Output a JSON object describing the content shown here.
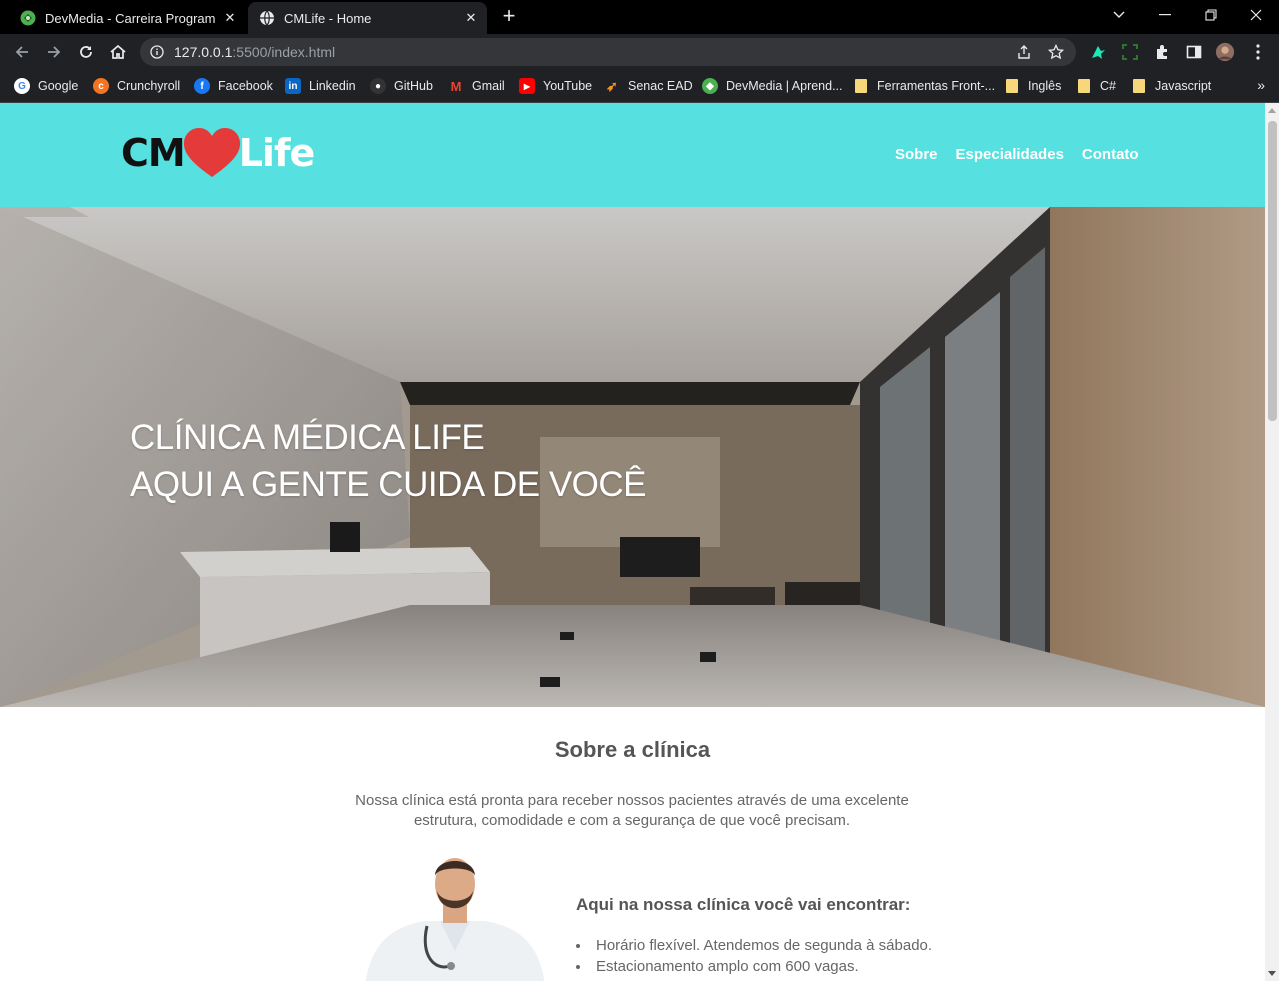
{
  "browser": {
    "tabs": [
      {
        "title": "DevMedia - Carreira Programador",
        "active": false
      },
      {
        "title": "CMLife - Home",
        "active": true
      }
    ],
    "url": {
      "host": "127.0.0.1",
      "path": ":5500/index.html"
    },
    "bookmarks": [
      {
        "label": "Google",
        "icon": "google-icon",
        "color": "#4285f4"
      },
      {
        "label": "Crunchyroll",
        "icon": "crunchyroll-icon",
        "color": "#f47521"
      },
      {
        "label": "Facebook",
        "icon": "facebook-icon",
        "color": "#1877f2"
      },
      {
        "label": "Linkedin",
        "icon": "linkedin-icon",
        "color": "#0a66c2"
      },
      {
        "label": "GitHub",
        "icon": "github-icon",
        "color": "#333333"
      },
      {
        "label": "Gmail",
        "icon": "gmail-icon",
        "color": "#ea4335"
      },
      {
        "label": "YouTube",
        "icon": "youtube-icon",
        "color": "#ff0000"
      },
      {
        "label": "Senac EAD",
        "icon": "senac-icon",
        "color": "#f7941d"
      },
      {
        "label": "DevMedia | Aprend...",
        "icon": "devmedia-icon",
        "color": "#2e7d32"
      },
      {
        "label": "Ferramentas Front-...",
        "icon": "folder-icon",
        "color": "#f6d77a"
      },
      {
        "label": "Inglês",
        "icon": "folder-icon",
        "color": "#f6d77a"
      },
      {
        "label": "C#",
        "icon": "folder-icon",
        "color": "#f6d77a"
      },
      {
        "label": "Javascript",
        "icon": "folder-icon",
        "color": "#f6d77a"
      }
    ]
  },
  "site": {
    "logo": {
      "left": "CM",
      "right": "Life"
    },
    "nav": [
      "Sobre",
      "Especialidades",
      "Contato"
    ],
    "hero": {
      "line1": "CLÍNICA MÉDICA LIFE",
      "line2": "AQUI A GENTE CUIDA DE VOCÊ"
    },
    "about": {
      "title": "Sobre a clínica",
      "intro": "Nossa clínica está pronta para receber nossos pacientes através de uma excelente estrutura, comodidade e com a segurança de que você precisam.",
      "features_title": "Aqui na nossa clínica você vai encontrar:",
      "features": [
        "Horário flexível. Atendemos de segunda à sábado.",
        "Estacionamento amplo com 600 vagas."
      ]
    },
    "colors": {
      "header": "#56e0e0",
      "heart": "#e53a3a"
    }
  }
}
